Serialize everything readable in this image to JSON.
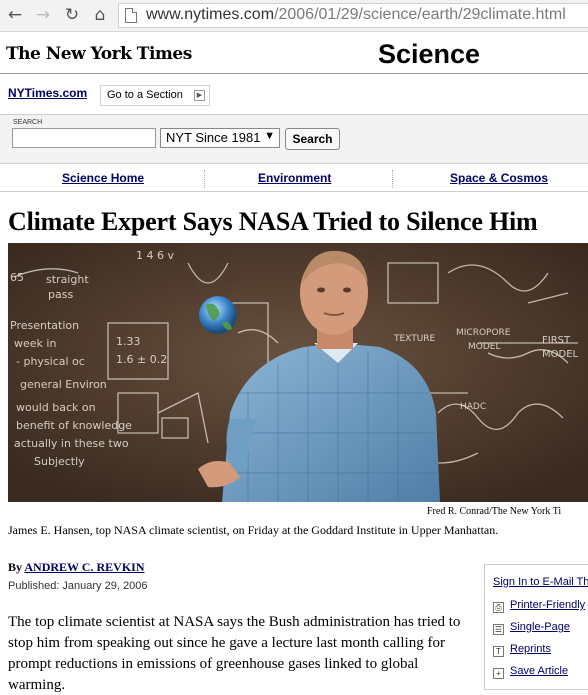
{
  "browser": {
    "url_host": "www.nytimes.com",
    "url_path": "/2006/01/29/science/earth/29climate.html"
  },
  "masthead": {
    "logo_text": "The New York Times",
    "section": "Science",
    "home_link": "NYTimes.com",
    "goto_label": "Go to a Section"
  },
  "search": {
    "label": "SEARCH",
    "scope": "NYT Since 1981",
    "button": "Search"
  },
  "subnav": {
    "items": [
      "Science Home",
      "Environment",
      "Space & Cosmos"
    ]
  },
  "article": {
    "headline": "Climate Expert Says NASA Tried to Silence Him",
    "photo_credit": "Fred R. Conrad/The New York Ti",
    "caption": "James E. Hansen, top NASA climate scientist, on Friday at the Goddard Institute in Upper Manhattan.",
    "by_prefix": "By",
    "author": "ANDREW C. REVKIN",
    "published": "Published: January 29, 2006",
    "lead": "The top climate scientist at NASA says the Bush administration has tried to stop him from speaking out since he gave a lecture last month calling for prompt reductions in emissions of greenhouse gases linked to global warming."
  },
  "tools": {
    "email": "Sign In to E-Mail Th",
    "print": "Printer-Friendly",
    "single": "Single-Page",
    "reprints": "Reprints",
    "save": "Save Article"
  },
  "chalk": {
    "t1": "65",
    "t2": "straight",
    "t3": "pass",
    "t4": "1 4 6 v",
    "t5": "Presentation",
    "t6": "week in",
    "t7": "- physical oc",
    "t8": "general Environ",
    "t9": "1.33",
    "t10": "1.6 ± 0.2",
    "t11": "would back on",
    "t12": "benefit of knowledge",
    "t13": "actually in these two",
    "t14": "Subjectly",
    "t15": "TEXTURE",
    "t16": "MICROPORE",
    "t17": "MODEL",
    "t18": "HADC",
    "t19": "FIRST",
    "t20": "MODEL"
  },
  "colors": {
    "link": "#000066",
    "board": "#4c3a2c",
    "shirt": "#6f9fc4"
  }
}
